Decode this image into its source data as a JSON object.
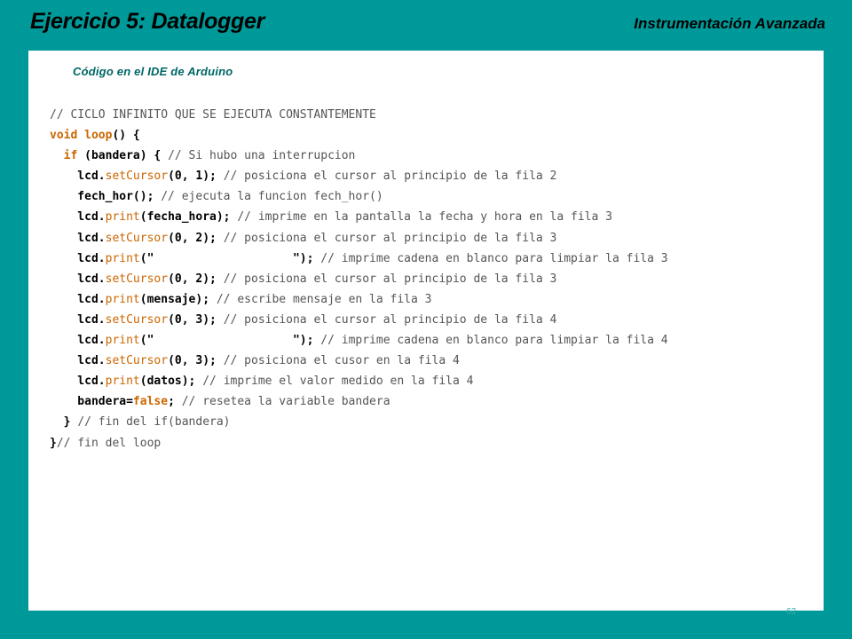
{
  "header": {
    "title": "Ejercicio 5: Datalogger",
    "subtitle": "Instrumentación Avanzada"
  },
  "panel": {
    "caption": "Código  en el IDE de Arduino"
  },
  "code_lines": [
    [
      {
        "t": "// CICLO INFINITO QUE SE EJECUTA CONSTANTEMENTE",
        "c": "cm"
      }
    ],
    [
      {
        "t": "void",
        "c": "kw"
      },
      {
        "t": " ",
        "c": "id"
      },
      {
        "t": "loop",
        "c": "kw"
      },
      {
        "t": "() {",
        "c": "id"
      }
    ],
    [
      {
        "t": "  ",
        "c": "id"
      },
      {
        "t": "if",
        "c": "kw"
      },
      {
        "t": " (bandera) { ",
        "c": "id"
      },
      {
        "t": "// Si hubo una interrupcion",
        "c": "cm"
      }
    ],
    [
      {
        "t": "    lcd.",
        "c": "id"
      },
      {
        "t": "setCursor",
        "c": "fn"
      },
      {
        "t": "(0, 1); ",
        "c": "id"
      },
      {
        "t": "// posiciona el cursor al principio de la fila 2",
        "c": "cm"
      }
    ],
    [
      {
        "t": "    fech_hor(); ",
        "c": "id"
      },
      {
        "t": "// ejecuta la funcion fech_hor()",
        "c": "cm"
      }
    ],
    [
      {
        "t": "    lcd.",
        "c": "id"
      },
      {
        "t": "print",
        "c": "fn"
      },
      {
        "t": "(fecha_hora); ",
        "c": "id"
      },
      {
        "t": "// imprime en la pantalla la fecha y hora en la fila 3",
        "c": "cm"
      }
    ],
    [
      {
        "t": "    lcd.",
        "c": "id"
      },
      {
        "t": "setCursor",
        "c": "fn"
      },
      {
        "t": "(0, 2); ",
        "c": "id"
      },
      {
        "t": "// posiciona el cursor al principio de la fila 3",
        "c": "cm"
      }
    ],
    [
      {
        "t": "    lcd.",
        "c": "id"
      },
      {
        "t": "print",
        "c": "fn"
      },
      {
        "t": "(\"                    \"); ",
        "c": "id"
      },
      {
        "t": "// imprime cadena en blanco para limpiar la fila 3",
        "c": "cm"
      }
    ],
    [
      {
        "t": "    lcd.",
        "c": "id"
      },
      {
        "t": "setCursor",
        "c": "fn"
      },
      {
        "t": "(0, 2); ",
        "c": "id"
      },
      {
        "t": "// posiciona el cursor al principio de la fila 3",
        "c": "cm"
      }
    ],
    [
      {
        "t": "    lcd.",
        "c": "id"
      },
      {
        "t": "print",
        "c": "fn"
      },
      {
        "t": "(mensaje); ",
        "c": "id"
      },
      {
        "t": "// escribe mensaje en la fila 3",
        "c": "cm"
      }
    ],
    [
      {
        "t": "    lcd.",
        "c": "id"
      },
      {
        "t": "setCursor",
        "c": "fn"
      },
      {
        "t": "(0, 3); ",
        "c": "id"
      },
      {
        "t": "// posiciona el cursor al principio de la fila 4",
        "c": "cm"
      }
    ],
    [
      {
        "t": "    lcd.",
        "c": "id"
      },
      {
        "t": "print",
        "c": "fn"
      },
      {
        "t": "(\"                    \"); ",
        "c": "id"
      },
      {
        "t": "// imprime cadena en blanco para limpiar la fila 4",
        "c": "cm"
      }
    ],
    [
      {
        "t": "    lcd.",
        "c": "id"
      },
      {
        "t": "setCursor",
        "c": "fn"
      },
      {
        "t": "(0, 3); ",
        "c": "id"
      },
      {
        "t": "// posiciona el cusor en la fila 4",
        "c": "cm"
      }
    ],
    [
      {
        "t": "    lcd.",
        "c": "id"
      },
      {
        "t": "print",
        "c": "fn"
      },
      {
        "t": "(datos); ",
        "c": "id"
      },
      {
        "t": "// imprime el valor medido en la fila 4",
        "c": "cm"
      }
    ],
    [
      {
        "t": "    bandera=",
        "c": "id"
      },
      {
        "t": "false",
        "c": "kw"
      },
      {
        "t": "; ",
        "c": "id"
      },
      {
        "t": "// resetea la variable bandera",
        "c": "cm"
      }
    ],
    [
      {
        "t": "  } ",
        "c": "id"
      },
      {
        "t": "// fin del if(bandera)",
        "c": "cm"
      }
    ],
    [
      {
        "t": "}",
        "c": "id"
      },
      {
        "t": "// fin del loop",
        "c": "cm"
      }
    ]
  ],
  "page_number": "63"
}
